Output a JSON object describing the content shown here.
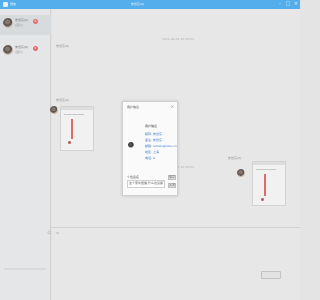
{
  "window": {
    "app_name": "微信",
    "chat_title": "朱世东(6)",
    "accent_color": "#2f9de8",
    "controls": [
      "-",
      "□",
      "×"
    ]
  },
  "sidebar": {
    "contacts": [
      {
        "name": "朱世东(6)",
        "preview": "[图片]",
        "badge": "6"
      },
      {
        "name": "朱世东(6)",
        "preview": "[图片]",
        "badge": "6"
      }
    ]
  },
  "chat": {
    "timestamp_top": "2021-02-05 10:25:53",
    "timestamp_mid": "2021-02-05 10:25:53",
    "sender_label": "朱世东(6)",
    "toolbar_icons": [
      "smile-icon",
      "folder-icon"
    ],
    "send_label": "发送(S)"
  },
  "modal": {
    "title": "用户信息",
    "close": "×",
    "name": "用户信息",
    "fields": [
      "昵称: 朱世东",
      "备注: 朱世东",
      "邮箱: admin@ziloo.cn",
      "地区: 上海",
      "电话: 0"
    ],
    "section_label": "个性签名",
    "signature": "这个家伙很懒,什么也没留下。",
    "btn1": "保存",
    "btn2": "关闭"
  }
}
